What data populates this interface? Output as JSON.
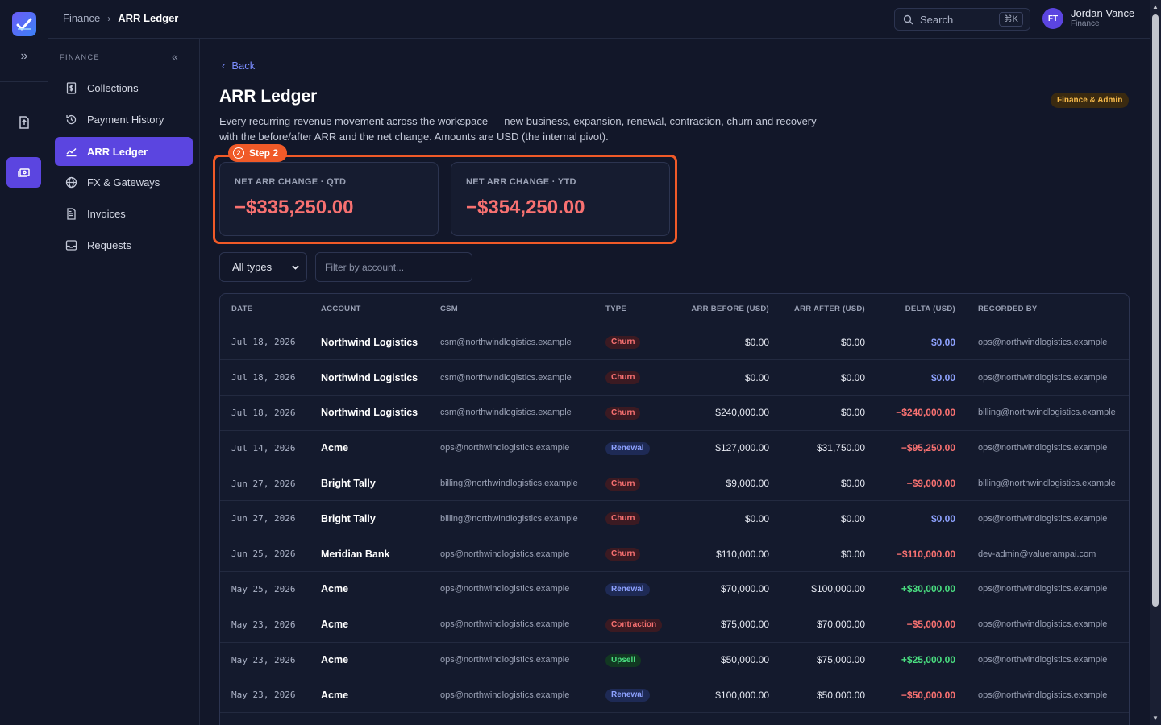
{
  "colors": {
    "accent": "#5b45e0",
    "negative": "#f87171",
    "positive": "#4ade80",
    "zero": "#8ea2ff",
    "highlight": "#f05a28",
    "pill_churn": {
      "bg": "#3b1a22",
      "fg": "#f87171"
    },
    "pill_renewal": {
      "bg": "#1e2a55",
      "fg": "#8ea2ff"
    },
    "pill_contraction": {
      "bg": "#3b1a22",
      "fg": "#f87171"
    },
    "pill_upsell": {
      "bg": "#123822",
      "fg": "#4ade80"
    }
  },
  "header": {
    "breadcrumb": {
      "parent": "Finance",
      "current": "ARR Ledger"
    },
    "search": {
      "label": "Search",
      "shortcut": "⌘K"
    },
    "user": {
      "initials": "FT",
      "name": "Jordan Vance",
      "role": "Finance"
    }
  },
  "sidebar": {
    "section": "FINANCE",
    "items": [
      {
        "label": "Collections",
        "icon": "dollar-doc-icon"
      },
      {
        "label": "Payment History",
        "icon": "history-icon"
      },
      {
        "label": "ARR Ledger",
        "icon": "trend-icon",
        "active": true
      },
      {
        "label": "FX & Gateways",
        "icon": "globe-icon"
      },
      {
        "label": "Invoices",
        "icon": "invoice-icon"
      },
      {
        "label": "Requests",
        "icon": "inbox-icon"
      }
    ]
  },
  "page": {
    "back": "Back",
    "title": "ARR Ledger",
    "badge": "Finance & Admin",
    "description": "Every recurring-revenue movement across the workspace — new business, expansion, renewal, contraction, churn and recovery — with the before/after ARR and the net change. Amounts are USD (the internal pivot).",
    "step": {
      "number": "2",
      "label": "Step 2"
    },
    "cards": [
      {
        "label": "NET ARR CHANGE · QTD",
        "value": "−$335,250.00"
      },
      {
        "label": "NET ARR CHANGE · YTD",
        "value": "−$354,250.00"
      }
    ],
    "filters": {
      "type_selected": "All types",
      "account_placeholder": "Filter by account..."
    }
  },
  "table": {
    "columns": [
      "DATE",
      "ACCOUNT",
      "CSM",
      "TYPE",
      "ARR BEFORE (USD)",
      "ARR AFTER (USD)",
      "DELTA (USD)",
      "RECORDED BY"
    ],
    "rows": [
      {
        "date": "Jul 18, 2026",
        "account": "Northwind Logistics",
        "csm": "csm@northwindlogistics.example",
        "type": "Churn",
        "before": "$0.00",
        "after": "$0.00",
        "delta": "$0.00",
        "sign": "zero",
        "by": "ops@northwindlogistics.example"
      },
      {
        "date": "Jul 18, 2026",
        "account": "Northwind Logistics",
        "csm": "csm@northwindlogistics.example",
        "type": "Churn",
        "before": "$0.00",
        "after": "$0.00",
        "delta": "$0.00",
        "sign": "zero",
        "by": "ops@northwindlogistics.example"
      },
      {
        "date": "Jul 18, 2026",
        "account": "Northwind Logistics",
        "csm": "csm@northwindlogistics.example",
        "type": "Churn",
        "before": "$240,000.00",
        "after": "$0.00",
        "delta": "−$240,000.00",
        "sign": "neg",
        "by": "billing@northwindlogistics.example"
      },
      {
        "date": "Jul 14, 2026",
        "account": "Acme",
        "csm": "ops@northwindlogistics.example",
        "type": "Renewal",
        "before": "$127,000.00",
        "after": "$31,750.00",
        "delta": "−$95,250.00",
        "sign": "neg",
        "by": "ops@northwindlogistics.example"
      },
      {
        "date": "Jun 27, 2026",
        "account": "Bright Tally",
        "csm": "billing@northwindlogistics.example",
        "type": "Churn",
        "before": "$9,000.00",
        "after": "$0.00",
        "delta": "−$9,000.00",
        "sign": "neg",
        "by": "billing@northwindlogistics.example"
      },
      {
        "date": "Jun 27, 2026",
        "account": "Bright Tally",
        "csm": "billing@northwindlogistics.example",
        "type": "Churn",
        "before": "$0.00",
        "after": "$0.00",
        "delta": "$0.00",
        "sign": "zero",
        "by": "ops@northwindlogistics.example"
      },
      {
        "date": "Jun 25, 2026",
        "account": "Meridian Bank",
        "csm": "ops@northwindlogistics.example",
        "type": "Churn",
        "before": "$110,000.00",
        "after": "$0.00",
        "delta": "−$110,000.00",
        "sign": "neg",
        "by": "dev-admin@valuerampai.com"
      },
      {
        "date": "May 25, 2026",
        "account": "Acme",
        "csm": "ops@northwindlogistics.example",
        "type": "Renewal",
        "before": "$70,000.00",
        "after": "$100,000.00",
        "delta": "+$30,000.00",
        "sign": "pos",
        "by": "ops@northwindlogistics.example"
      },
      {
        "date": "May 23, 2026",
        "account": "Acme",
        "csm": "ops@northwindlogistics.example",
        "type": "Contraction",
        "before": "$75,000.00",
        "after": "$70,000.00",
        "delta": "−$5,000.00",
        "sign": "neg",
        "by": "ops@northwindlogistics.example"
      },
      {
        "date": "May 23, 2026",
        "account": "Acme",
        "csm": "ops@northwindlogistics.example",
        "type": "Upsell",
        "before": "$50,000.00",
        "after": "$75,000.00",
        "delta": "+$25,000.00",
        "sign": "pos",
        "by": "ops@northwindlogistics.example"
      },
      {
        "date": "May 23, 2026",
        "account": "Acme",
        "csm": "ops@northwindlogistics.example",
        "type": "Renewal",
        "before": "$100,000.00",
        "after": "$50,000.00",
        "delta": "−$50,000.00",
        "sign": "neg",
        "by": "ops@northwindlogistics.example"
      }
    ]
  }
}
